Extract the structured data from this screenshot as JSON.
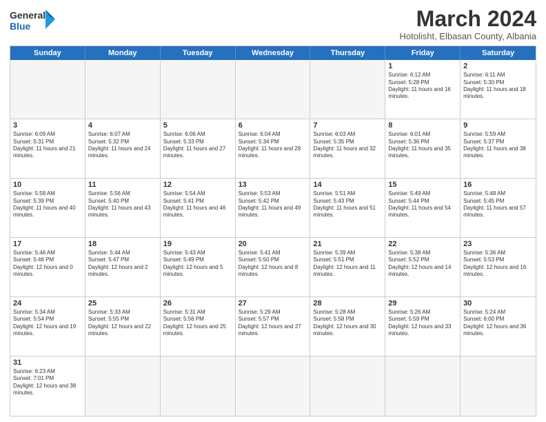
{
  "logo": {
    "general": "General",
    "blue": "Blue"
  },
  "header": {
    "title": "March 2024",
    "subtitle": "Hotolisht, Elbasan County, Albania"
  },
  "weekdays": [
    "Sunday",
    "Monday",
    "Tuesday",
    "Wednesday",
    "Thursday",
    "Friday",
    "Saturday"
  ],
  "weeks": [
    [
      {
        "day": "",
        "info": "",
        "empty": true
      },
      {
        "day": "",
        "info": "",
        "empty": true
      },
      {
        "day": "",
        "info": "",
        "empty": true
      },
      {
        "day": "",
        "info": "",
        "empty": true
      },
      {
        "day": "",
        "info": "",
        "empty": true
      },
      {
        "day": "1",
        "info": "Sunrise: 6:12 AM\nSunset: 5:28 PM\nDaylight: 11 hours and 16 minutes."
      },
      {
        "day": "2",
        "info": "Sunrise: 6:11 AM\nSunset: 5:30 PM\nDaylight: 11 hours and 18 minutes."
      }
    ],
    [
      {
        "day": "3",
        "info": "Sunrise: 6:09 AM\nSunset: 5:31 PM\nDaylight: 11 hours and 21 minutes."
      },
      {
        "day": "4",
        "info": "Sunrise: 6:07 AM\nSunset: 5:32 PM\nDaylight: 11 hours and 24 minutes."
      },
      {
        "day": "5",
        "info": "Sunrise: 6:06 AM\nSunset: 5:33 PM\nDaylight: 11 hours and 27 minutes."
      },
      {
        "day": "6",
        "info": "Sunrise: 6:04 AM\nSunset: 5:34 PM\nDaylight: 11 hours and 29 minutes."
      },
      {
        "day": "7",
        "info": "Sunrise: 6:03 AM\nSunset: 5:35 PM\nDaylight: 11 hours and 32 minutes."
      },
      {
        "day": "8",
        "info": "Sunrise: 6:01 AM\nSunset: 5:36 PM\nDaylight: 11 hours and 35 minutes."
      },
      {
        "day": "9",
        "info": "Sunrise: 5:59 AM\nSunset: 5:37 PM\nDaylight: 11 hours and 38 minutes."
      }
    ],
    [
      {
        "day": "10",
        "info": "Sunrise: 5:58 AM\nSunset: 5:39 PM\nDaylight: 11 hours and 40 minutes."
      },
      {
        "day": "11",
        "info": "Sunrise: 5:56 AM\nSunset: 5:40 PM\nDaylight: 11 hours and 43 minutes."
      },
      {
        "day": "12",
        "info": "Sunrise: 5:54 AM\nSunset: 5:41 PM\nDaylight: 11 hours and 46 minutes."
      },
      {
        "day": "13",
        "info": "Sunrise: 5:53 AM\nSunset: 5:42 PM\nDaylight: 11 hours and 49 minutes."
      },
      {
        "day": "14",
        "info": "Sunrise: 5:51 AM\nSunset: 5:43 PM\nDaylight: 11 hours and 51 minutes."
      },
      {
        "day": "15",
        "info": "Sunrise: 5:49 AM\nSunset: 5:44 PM\nDaylight: 11 hours and 54 minutes."
      },
      {
        "day": "16",
        "info": "Sunrise: 5:48 AM\nSunset: 5:45 PM\nDaylight: 11 hours and 57 minutes."
      }
    ],
    [
      {
        "day": "17",
        "info": "Sunrise: 5:46 AM\nSunset: 5:46 PM\nDaylight: 12 hours and 0 minutes."
      },
      {
        "day": "18",
        "info": "Sunrise: 5:44 AM\nSunset: 5:47 PM\nDaylight: 12 hours and 2 minutes."
      },
      {
        "day": "19",
        "info": "Sunrise: 5:43 AM\nSunset: 5:49 PM\nDaylight: 12 hours and 5 minutes."
      },
      {
        "day": "20",
        "info": "Sunrise: 5:41 AM\nSunset: 5:50 PM\nDaylight: 12 hours and 8 minutes."
      },
      {
        "day": "21",
        "info": "Sunrise: 5:39 AM\nSunset: 5:51 PM\nDaylight: 12 hours and 11 minutes."
      },
      {
        "day": "22",
        "info": "Sunrise: 5:38 AM\nSunset: 5:52 PM\nDaylight: 12 hours and 14 minutes."
      },
      {
        "day": "23",
        "info": "Sunrise: 5:36 AM\nSunset: 5:53 PM\nDaylight: 12 hours and 16 minutes."
      }
    ],
    [
      {
        "day": "24",
        "info": "Sunrise: 5:34 AM\nSunset: 5:54 PM\nDaylight: 12 hours and 19 minutes."
      },
      {
        "day": "25",
        "info": "Sunrise: 5:33 AM\nSunset: 5:55 PM\nDaylight: 12 hours and 22 minutes."
      },
      {
        "day": "26",
        "info": "Sunrise: 5:31 AM\nSunset: 5:56 PM\nDaylight: 12 hours and 25 minutes."
      },
      {
        "day": "27",
        "info": "Sunrise: 5:29 AM\nSunset: 5:57 PM\nDaylight: 12 hours and 27 minutes."
      },
      {
        "day": "28",
        "info": "Sunrise: 5:28 AM\nSunset: 5:58 PM\nDaylight: 12 hours and 30 minutes."
      },
      {
        "day": "29",
        "info": "Sunrise: 5:26 AM\nSunset: 5:59 PM\nDaylight: 12 hours and 33 minutes."
      },
      {
        "day": "30",
        "info": "Sunrise: 5:24 AM\nSunset: 6:00 PM\nDaylight: 12 hours and 36 minutes."
      }
    ],
    [
      {
        "day": "31",
        "info": "Sunrise: 6:23 AM\nSunset: 7:01 PM\nDaylight: 12 hours and 38 minutes."
      },
      {
        "day": "",
        "info": "",
        "empty": true
      },
      {
        "day": "",
        "info": "",
        "empty": true
      },
      {
        "day": "",
        "info": "",
        "empty": true
      },
      {
        "day": "",
        "info": "",
        "empty": true
      },
      {
        "day": "",
        "info": "",
        "empty": true
      },
      {
        "day": "",
        "info": "",
        "empty": true
      }
    ]
  ]
}
